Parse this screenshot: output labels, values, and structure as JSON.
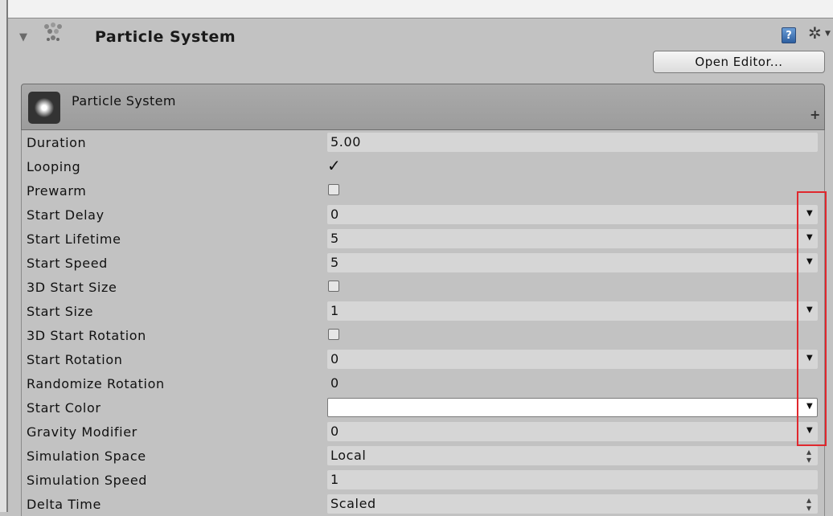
{
  "component": {
    "title": "Particle System",
    "help_glyph": "?",
    "gear_glyph": "✲",
    "open_editor_label": "Open Editor...",
    "foldout_glyph": "▼"
  },
  "module": {
    "title": "Particle System",
    "plus_glyph": "+"
  },
  "rows": [
    {
      "label": "Duration",
      "type": "value",
      "value": "5.00"
    },
    {
      "label": "Looping",
      "type": "checkbox",
      "checked": true
    },
    {
      "label": "Prewarm",
      "type": "checkbox",
      "checked": false
    },
    {
      "label": "Start Delay",
      "type": "value",
      "value": "0",
      "dropdown": true
    },
    {
      "label": "Start Lifetime",
      "type": "value",
      "value": "5",
      "dropdown": true
    },
    {
      "label": "Start Speed",
      "type": "value",
      "value": "5",
      "dropdown": true
    },
    {
      "label": "3D Start Size",
      "type": "checkbox",
      "checked": false
    },
    {
      "label": "Start Size",
      "type": "value",
      "value": "1",
      "dropdown": true
    },
    {
      "label": "3D Start Rotation",
      "type": "checkbox",
      "checked": false
    },
    {
      "label": "Start Rotation",
      "type": "value",
      "value": "0",
      "dropdown": true
    },
    {
      "label": "Randomize Rotation",
      "type": "value",
      "value": "0"
    },
    {
      "label": "Start Color",
      "type": "color",
      "value": "#ffffff",
      "dropdown": true
    },
    {
      "label": "Gravity Modifier",
      "type": "value",
      "value": "0",
      "dropdown": true
    },
    {
      "label": "Simulation Space",
      "type": "select",
      "value": "Local"
    },
    {
      "label": "Simulation Speed",
      "type": "value",
      "value": "1"
    },
    {
      "label": "Delta Time",
      "type": "select",
      "value": "Scaled"
    }
  ],
  "colors": {
    "highlight": "#e0282e",
    "panel": "#c2c2c2"
  }
}
